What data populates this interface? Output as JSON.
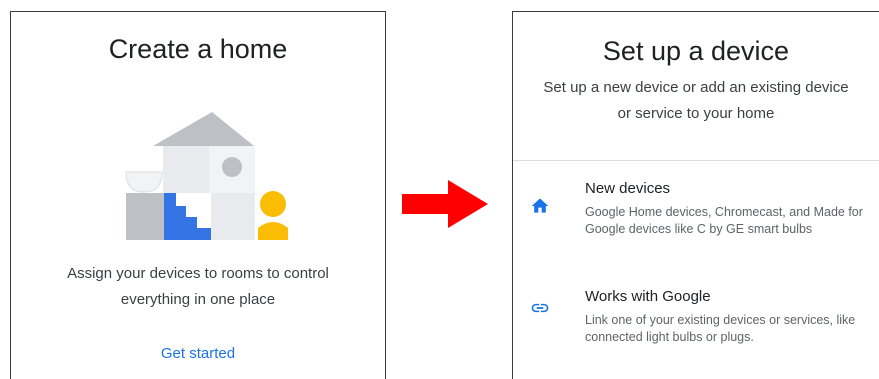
{
  "left_screen": {
    "title": "Create a home",
    "description": "Assign your devices to rooms to control everything in one place",
    "cta_label": "Get started"
  },
  "right_screen": {
    "title": "Set up a device",
    "subtitle": "Set up a new device or add an existing device or service to your home",
    "options": [
      {
        "icon": "home-icon",
        "title": "New devices",
        "description": "Google Home devices, Chromecast, and Made for Google devices like C by GE smart bulbs"
      },
      {
        "icon": "link-icon",
        "title": "Works with Google",
        "description": "Link one of your existing devices or services, like connected light bulbs or plugs."
      }
    ]
  },
  "colors": {
    "accent": "#1a73e8",
    "arrow": "#ff0000",
    "illustration_blue": "#4285f4",
    "illustration_yellow": "#fbbc04",
    "illustration_gray": "#dadce0"
  }
}
